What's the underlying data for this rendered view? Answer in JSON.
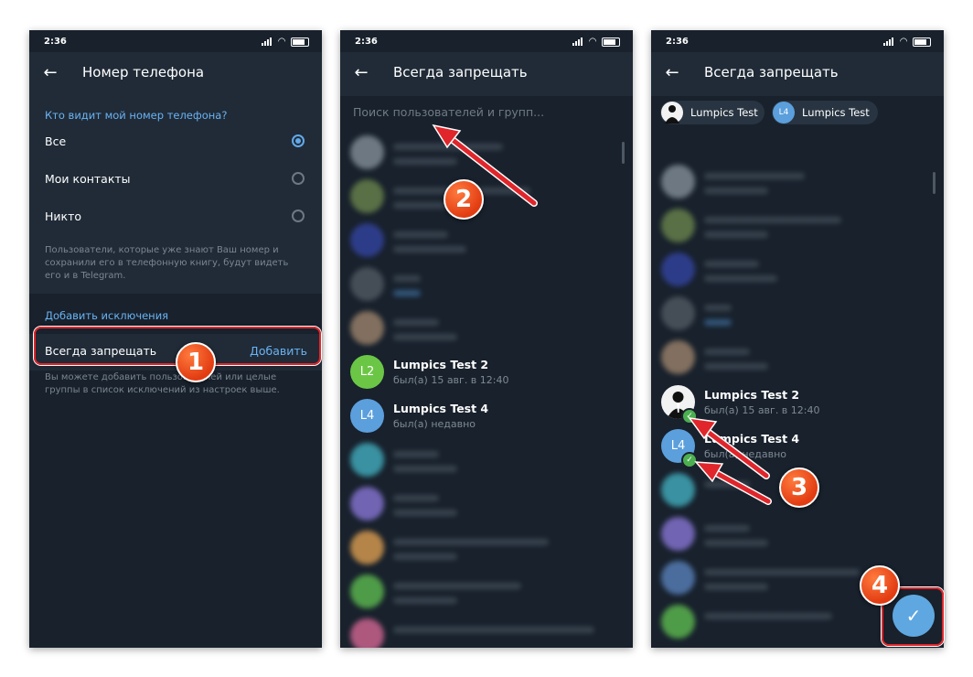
{
  "status_time": "2:36",
  "screen1": {
    "title": "Номер телефона",
    "section_header": "Кто видит мой номер телефона?",
    "options": [
      "Все",
      "Мои контакты",
      "Никто"
    ],
    "selected_index": 0,
    "hint": "Пользователи, которые уже знают Ваш номер и сохранили его в телефонную книгу, будут видеть его и в Telegram.",
    "exceptions_header": "Добавить исключения",
    "exception_label": "Всегда запрещать",
    "exception_action": "Добавить",
    "exceptions_hint": "Вы можете добавить пользователей или целые группы в список исключений из настроек выше."
  },
  "screen2": {
    "title": "Всегда запрещать",
    "search_placeholder": "Поиск пользователей и групп...",
    "contacts": [
      {
        "avatar_text": "L2",
        "avatar_color": "#6bc646",
        "name": "Lumpics Test 2",
        "status": "был(а) 15 авг. в 12:40"
      },
      {
        "avatar_text": "L4",
        "avatar_color": "#5b9fdc",
        "name": "Lumpics Test 4",
        "status": "был(а) недавно"
      }
    ]
  },
  "screen3": {
    "title": "Всегда запрещать",
    "chips": [
      {
        "avatar_text": "",
        "name": "Lumpics Test"
      },
      {
        "avatar_text": "L4",
        "avatar_color": "#5b9fdc",
        "name": "Lumpics Test"
      }
    ],
    "contacts": [
      {
        "avatar_text": "",
        "name": "Lumpics Test 2",
        "status": "был(а) 15 авг. в 12:40",
        "selected": true
      },
      {
        "avatar_text": "L4",
        "avatar_color": "#5b9fdc",
        "name": "Lumpics Test 4",
        "status": "был(а) недавно",
        "selected": true
      }
    ],
    "fab_icon": "checkmark-icon"
  },
  "annotations": {
    "step1": "1",
    "step2": "2",
    "step3": "3",
    "step4": "4",
    "highlight_color": "#e0262b",
    "badge_color": "#e8481a"
  },
  "colors": {
    "background": "#18212c",
    "toolbar": "#202b37",
    "accent": "#6ab3f3",
    "check": "#4caf50"
  }
}
